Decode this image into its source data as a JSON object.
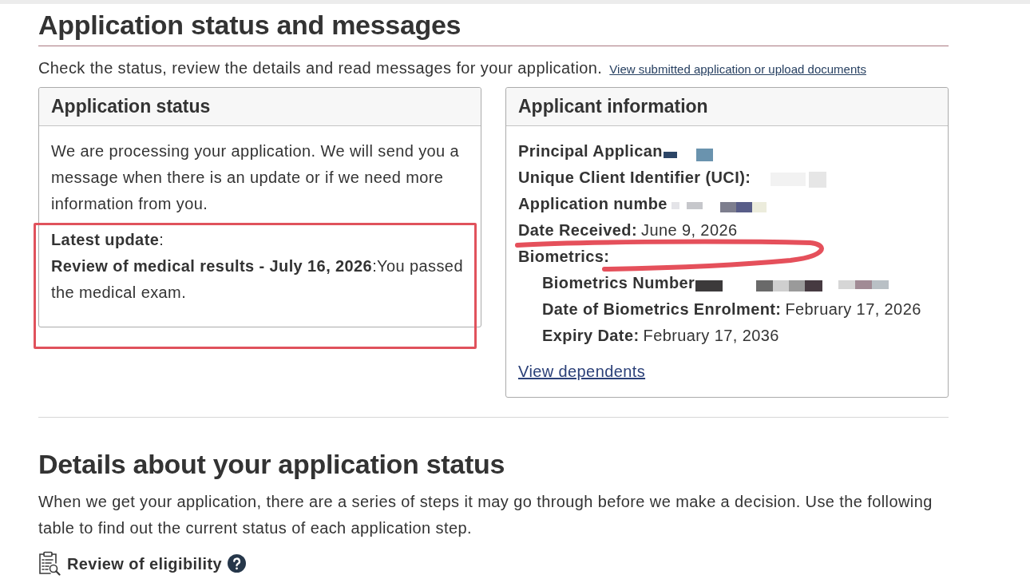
{
  "header": {
    "title": "Application status and messages",
    "intro": "Check the status, review the details and read messages for your application.",
    "link": "View submitted application or upload documents"
  },
  "application_status": {
    "title": "Application status",
    "message": "We are processing your application. We will send you a message when there is an update or if we need more information from you.",
    "latest_update": {
      "label": "**Latest update**:",
      "text": "**Review of medical results - July 16, 2026**:You passed the medical exam.",
      "boxed": true
    }
  },
  "applicant_information": {
    "title": "Applicant information",
    "fields": [
      {
        "label": "Principal Applican",
        "redacted": true
      },
      {
        "label": "Unique Client Identifier (UCI):",
        "redacted": true
      },
      {
        "label": "Application numbe",
        "redacted": true
      },
      {
        "label": "Date Received:",
        "value": "June 9, 2026",
        "circled": true
      },
      {
        "label": "Biometrics:",
        "children": [
          {
            "label": "Biometrics Number",
            "redacted": true
          },
          {
            "label": "Date of Biometrics Enrolment:",
            "value": "February 17, 2026"
          },
          {
            "label": "Expiry Date:",
            "value": "February 17, 2036"
          }
        ]
      }
    ],
    "link": "View dependents"
  },
  "details": {
    "title": "Details about your application status",
    "text": "When we get your application, there are a series of steps it may go through before we make a decision. Use the following table to find out the current status of each application step.",
    "steps": [
      {
        "label": "Review of eligibility"
      }
    ]
  }
}
